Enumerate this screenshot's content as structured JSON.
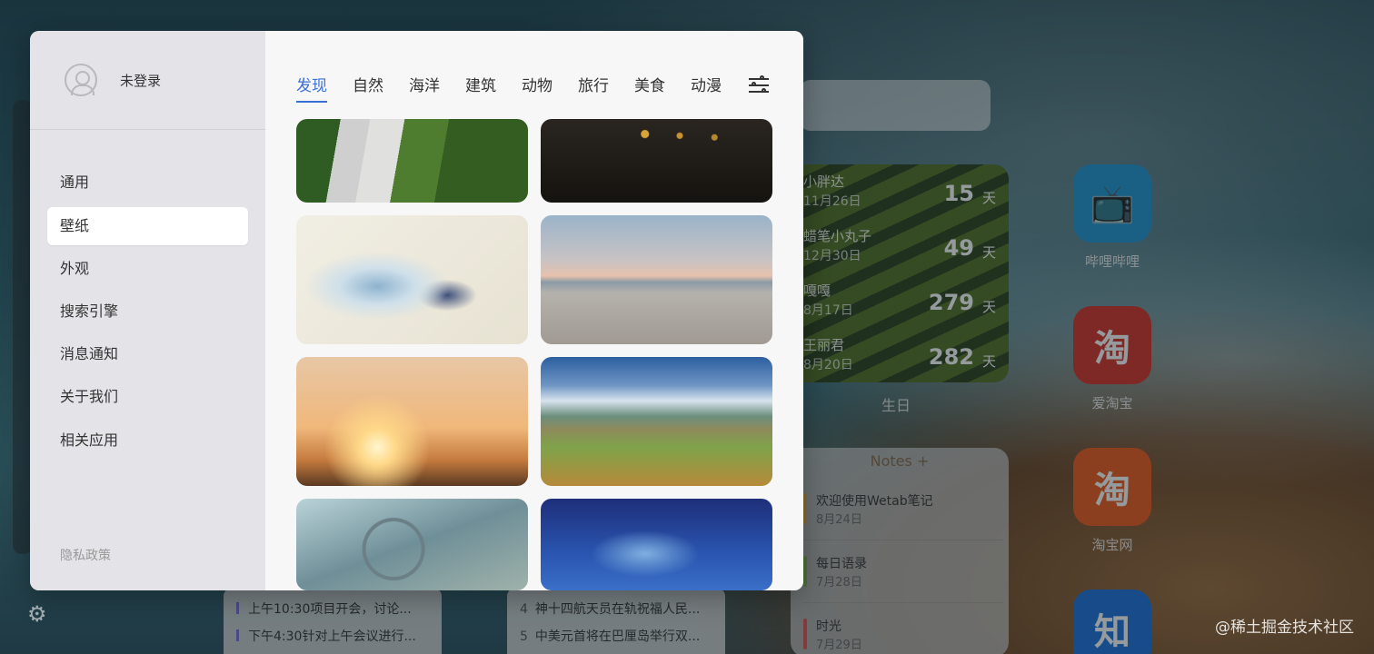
{
  "modal": {
    "user": {
      "login_label": "未登录"
    },
    "menu": [
      "通用",
      "壁纸",
      "外观",
      "搜索引擎",
      "消息通知",
      "关于我们",
      "相关应用"
    ],
    "active_menu": "壁纸",
    "privacy_label": "隐私政策",
    "tabs": [
      "发现",
      "自然",
      "海洋",
      "建筑",
      "动物",
      "旅行",
      "美食",
      "动漫"
    ],
    "active_tab": "发现"
  },
  "birthdays": {
    "label": "生日",
    "unit": "天",
    "rows": [
      {
        "name": "小胖达",
        "date": "11月26日",
        "days": "15"
      },
      {
        "name": "蜡笔小丸子",
        "date": "12月30日",
        "days": "49"
      },
      {
        "name": "嘎嘎",
        "date": "8月17日",
        "days": "279"
      },
      {
        "name": "王丽君",
        "date": "8月20日",
        "days": "282"
      }
    ]
  },
  "notes": {
    "title": "Notes +",
    "items": [
      {
        "text": "欢迎使用Wetab笔记",
        "date": "8月24日",
        "color": "#e0a640"
      },
      {
        "text": "每日语录",
        "date": "7月28日",
        "color": "#7fb04a"
      },
      {
        "text": "时光",
        "date": "7月29日",
        "color": "#e05050"
      }
    ]
  },
  "apps": [
    {
      "name": "哔哩哔哩",
      "glyph": "📺",
      "color": "#1f96d6"
    },
    {
      "name": "爱淘宝",
      "glyph": "淘",
      "color": "#d8322a"
    },
    {
      "name": "淘宝网",
      "glyph": "淘",
      "color": "#ef5a1c"
    },
    {
      "name": "",
      "glyph": "知",
      "color": "#1b6fdc"
    }
  ],
  "todo": [
    "上午10:30项目开会，讨论...",
    "下午4:30针对上午会议进行..."
  ],
  "hot": [
    {
      "no": "4",
      "text": "神十四航天员在轨祝福人民..."
    },
    {
      "no": "5",
      "text": "中美元首将在巴厘岛举行双..."
    }
  ],
  "watermark": "@稀土掘金技术社区"
}
